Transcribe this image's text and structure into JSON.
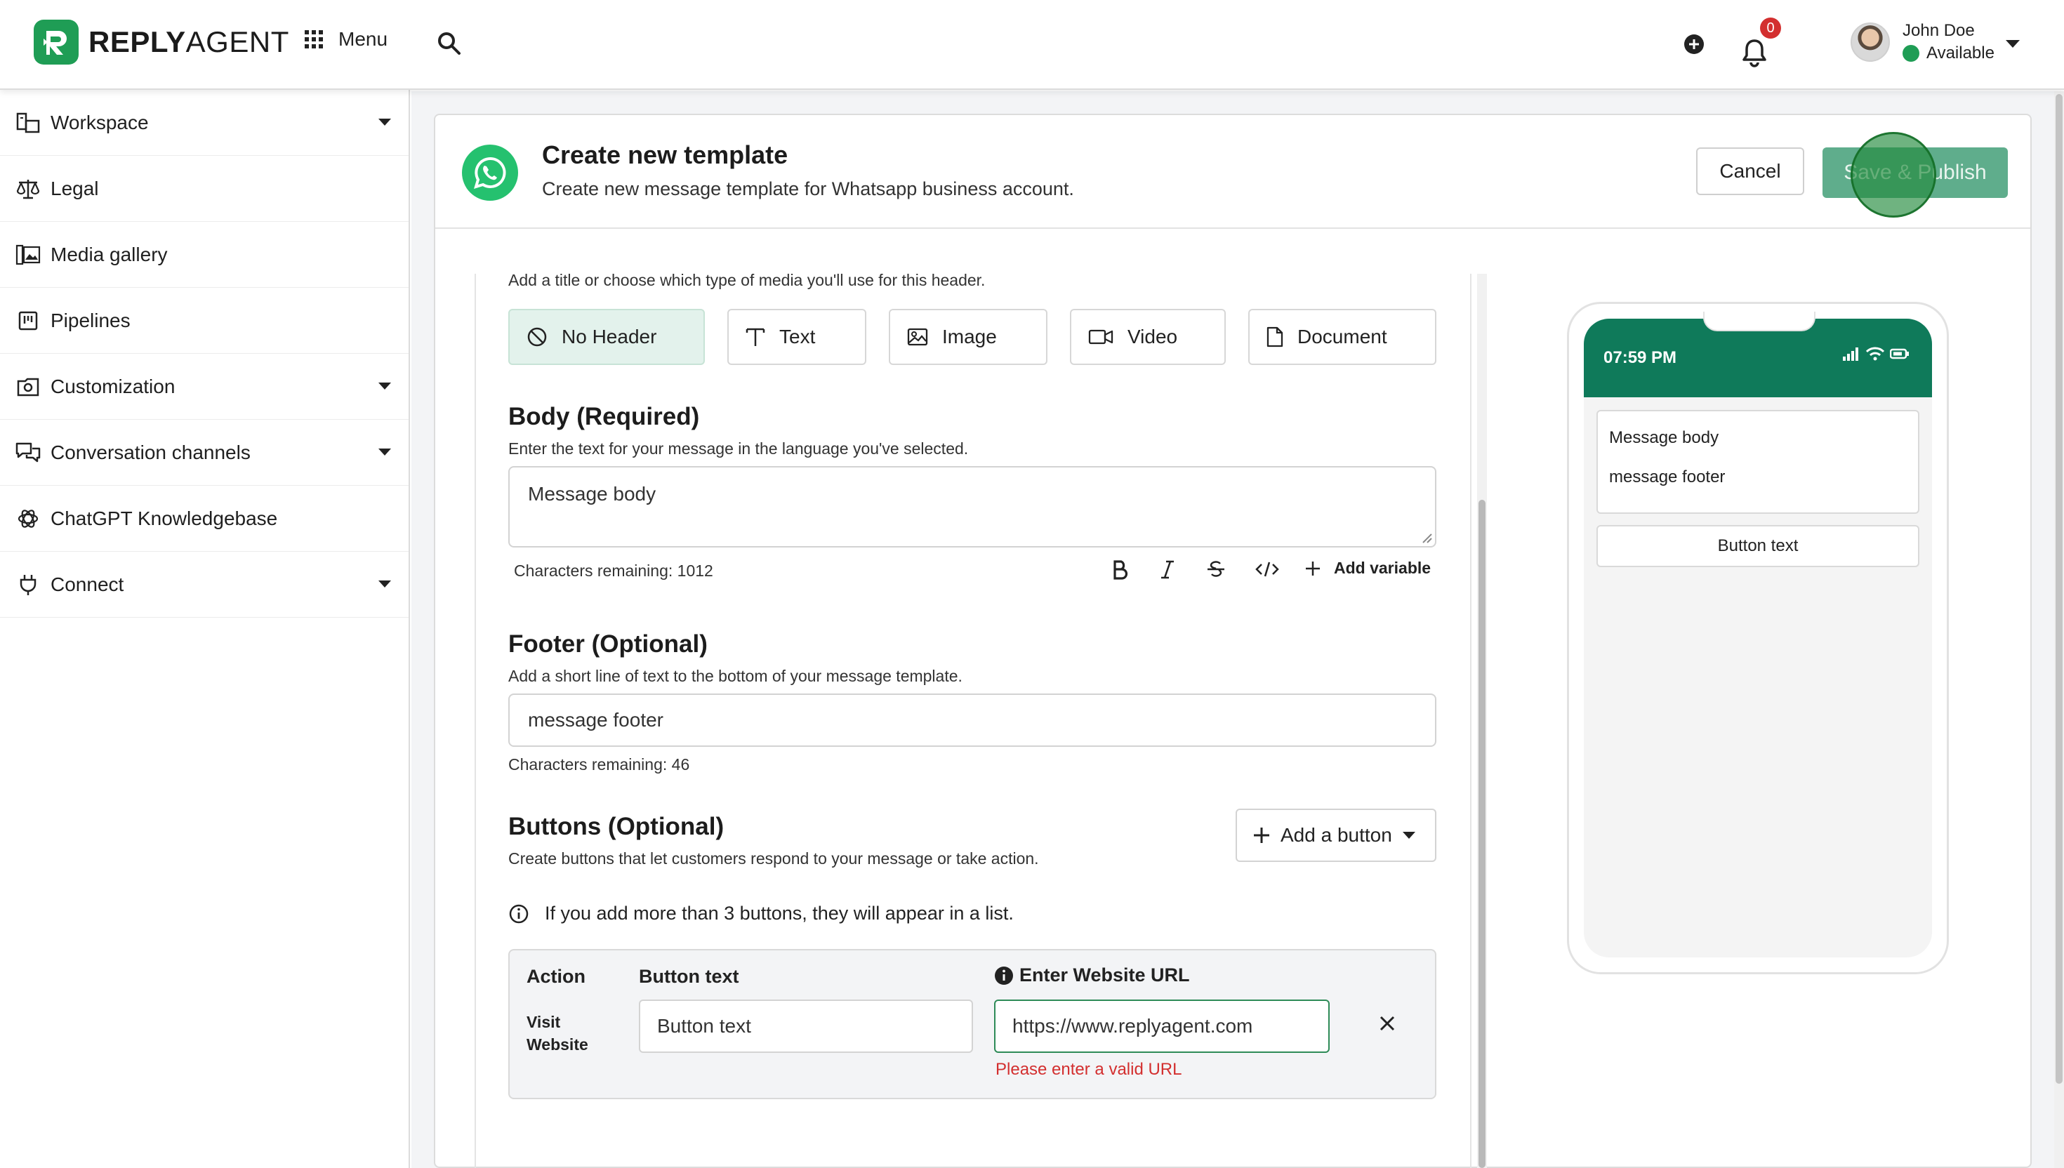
{
  "topbar": {
    "logo_bold": "REPLY",
    "logo_regular": "AGENT",
    "menu_label": "Menu",
    "notification_count": "0",
    "user_name": "John Doe",
    "user_status": "Available"
  },
  "sidebar": {
    "items": [
      {
        "label": "Workspace",
        "icon": "workspace-icon",
        "expandable": true
      },
      {
        "label": "Legal",
        "icon": "scales-icon",
        "expandable": false
      },
      {
        "label": "Media gallery",
        "icon": "gallery-icon",
        "expandable": false
      },
      {
        "label": "Pipelines",
        "icon": "pipeline-icon",
        "expandable": false
      },
      {
        "label": "Customization",
        "icon": "customize-icon",
        "expandable": true
      },
      {
        "label": "Conversation channels",
        "icon": "chat-icon",
        "expandable": true
      },
      {
        "label": "ChatGPT Knowledgebase",
        "icon": "openai-icon",
        "expandable": false
      },
      {
        "label": "Connect",
        "icon": "plug-icon",
        "expandable": true
      }
    ]
  },
  "header": {
    "title": "Create new template",
    "subtitle": "Create new message template for Whatsapp business account.",
    "cancel_label": "Cancel",
    "publish_label": "Save & Publish"
  },
  "form": {
    "header_hint": "Add a title or choose which type of media you'll use for this header.",
    "header_options": [
      {
        "label": "No Header",
        "icon": "no-header-icon",
        "active": true
      },
      {
        "label": "Text",
        "icon": "text-icon",
        "active": false
      },
      {
        "label": "Image",
        "icon": "image-icon",
        "active": false
      },
      {
        "label": "Video",
        "icon": "video-icon",
        "active": false
      },
      {
        "label": "Document",
        "icon": "document-icon",
        "active": false
      }
    ],
    "body": {
      "title": "Body (Required)",
      "hint": "Enter the text for your message in the language you've selected.",
      "value": "Message body",
      "chars_remaining": "Characters remaining: 1012",
      "add_variable_label": "Add variable"
    },
    "footer": {
      "title": "Footer (Optional)",
      "hint": "Add a short line of text to the bottom of your message template.",
      "value": "message footer",
      "chars_remaining": "Characters remaining: 46"
    },
    "buttons": {
      "title": "Buttons (Optional)",
      "hint": "Create buttons that let customers respond to your message or take action.",
      "add_label": "Add a button",
      "info": "If you add more than 3 buttons, they will appear in a list.",
      "table": {
        "col_action": "Action",
        "col_text": "Button text",
        "col_url": "Enter Website URL",
        "row_action_line1": "Visit",
        "row_action_line2": "Website",
        "row_text_value": "Button text",
        "row_url_value": "https://www.replyagent.com",
        "url_error": "Please enter a valid URL"
      }
    }
  },
  "preview": {
    "time": "07:59 PM",
    "body": "Message body",
    "footer": "message footer",
    "button": "Button text"
  },
  "colors": {
    "brand_green": "#1f9d55",
    "whatsapp_green": "#25c16f",
    "preview_bar": "#0f7a5a",
    "publish_button": "#5fad8c",
    "error_red": "#d32f2f",
    "badge_red": "#d32f2f"
  }
}
